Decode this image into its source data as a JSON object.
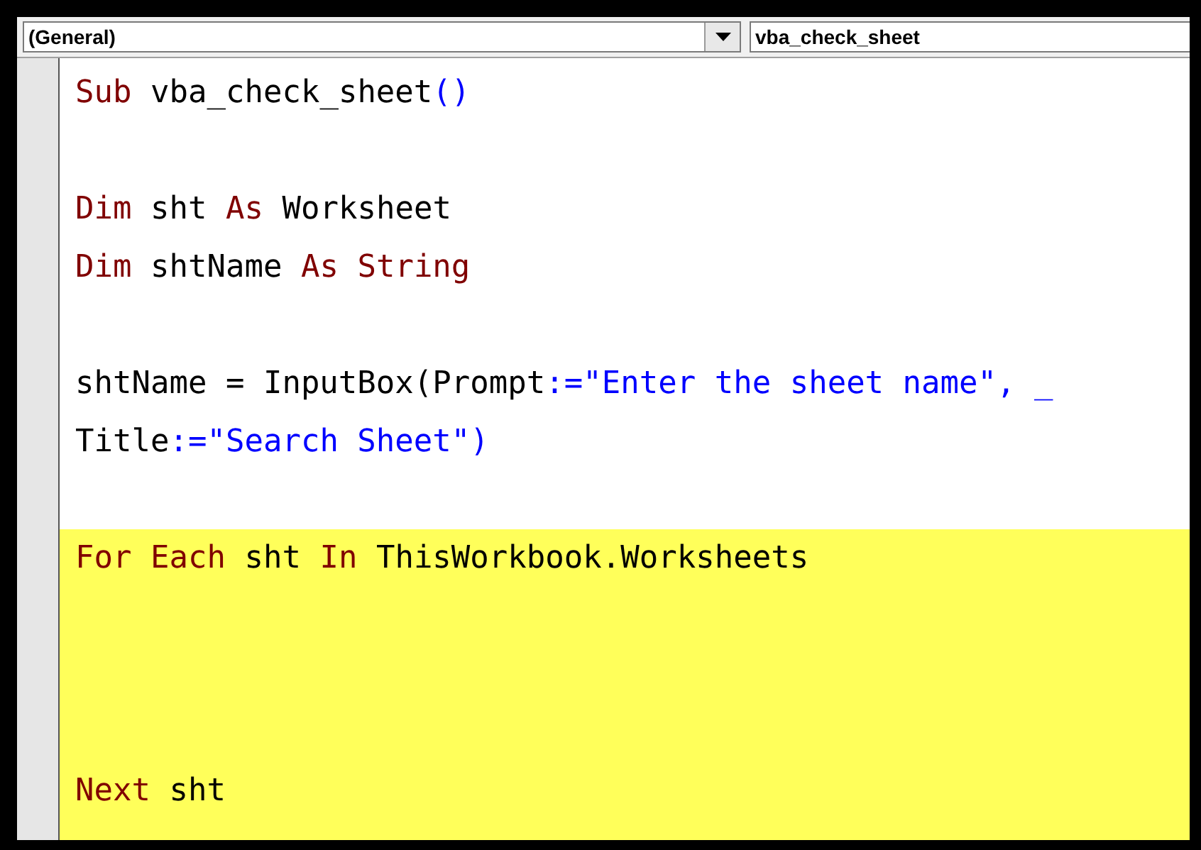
{
  "object_box": {
    "value": "(General)"
  },
  "procedure_box": {
    "value": "vba_check_sheet"
  },
  "code_lines": [
    {
      "highlighted": false,
      "tokens": [
        {
          "kind": "keyword",
          "text": "Sub"
        },
        {
          "kind": "plain",
          "text": " vba_check_sheet"
        },
        {
          "kind": "string",
          "text": "()"
        }
      ]
    },
    {
      "highlighted": false
    },
    {
      "highlighted": false,
      "tokens": [
        {
          "kind": "keyword",
          "text": "Dim"
        },
        {
          "kind": "plain",
          "text": " sht "
        },
        {
          "kind": "keyword",
          "text": "As"
        },
        {
          "kind": "plain",
          "text": " Worksheet"
        }
      ]
    },
    {
      "highlighted": false,
      "tokens": [
        {
          "kind": "keyword",
          "text": "Dim"
        },
        {
          "kind": "plain",
          "text": " shtName "
        },
        {
          "kind": "keyword",
          "text": "As String"
        }
      ]
    },
    {
      "highlighted": false
    },
    {
      "highlighted": false,
      "tokens": [
        {
          "kind": "plain",
          "text": "shtName = InputBox(Prompt"
        },
        {
          "kind": "string",
          "text": ":=\"Enter the sheet name\", _"
        }
      ]
    },
    {
      "highlighted": false,
      "tokens": [
        {
          "kind": "plain",
          "text": "Title"
        },
        {
          "kind": "string",
          "text": ":=\"Search Sheet\")"
        }
      ]
    },
    {
      "highlighted": false
    },
    {
      "highlighted": true,
      "tokens": [
        {
          "kind": "keyword",
          "text": "For Each"
        },
        {
          "kind": "plain",
          "text": " sht "
        },
        {
          "kind": "keyword",
          "text": "In"
        },
        {
          "kind": "plain",
          "text": " ThisWorkbook.Worksheets"
        }
      ]
    },
    {
      "highlighted": true
    },
    {
      "highlighted": true
    },
    {
      "highlighted": true
    },
    {
      "highlighted": true,
      "tokens": [
        {
          "kind": "keyword",
          "text": "Next"
        },
        {
          "kind": "plain",
          "text": " sht"
        }
      ]
    }
  ]
}
